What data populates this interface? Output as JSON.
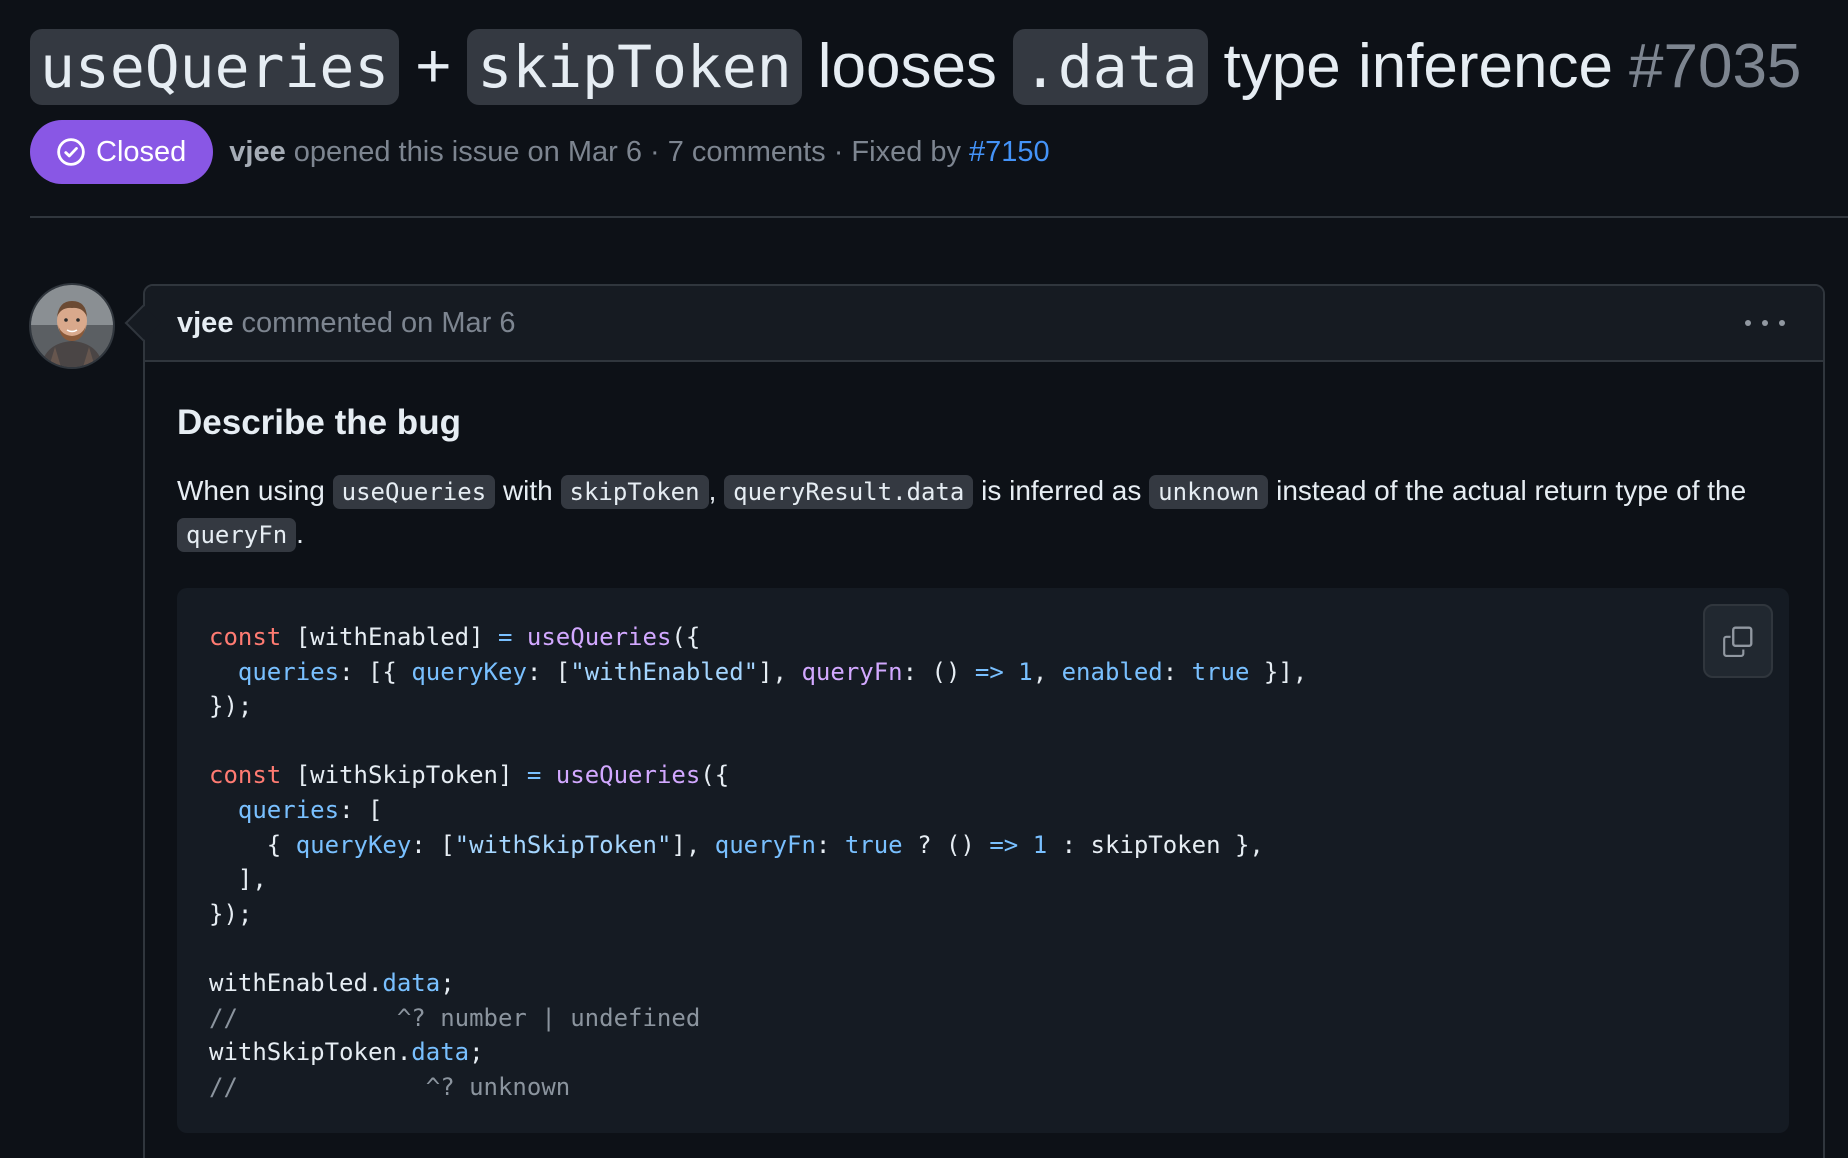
{
  "issue": {
    "title_parts": {
      "code1": "useQueries",
      "plus": "+",
      "code2": "skipToken",
      "word1": "looses",
      "code3": ".data",
      "rest": "type inference",
      "number": "#7035"
    },
    "status_label": "Closed",
    "status_color": "#8957e5",
    "author": "vjee",
    "opened_text": "opened this issue on Mar 6 · 7 comments · Fixed by",
    "fixed_by": "#7150"
  },
  "comment": {
    "author": "vjee",
    "meta": "commented on Mar 6",
    "heading": "Describe the bug",
    "para": {
      "t1": "When using",
      "c1": "useQueries",
      "t2": "with",
      "c2": "skipToken",
      "t3": ",",
      "c3": "queryResult.data",
      "t4": "is inferred as",
      "c4": "unknown",
      "t5": "instead of the actual return type of the",
      "c5": "queryFn",
      "t6": "."
    },
    "code_lines": [
      [
        {
          "t": "const",
          "c": "k"
        },
        {
          "t": " [withEnabled] "
        },
        {
          "t": "=",
          "c": "p"
        },
        {
          "t": " "
        },
        {
          "t": "useQueries",
          "c": "f"
        },
        {
          "t": "({"
        }
      ],
      [
        {
          "t": "  "
        },
        {
          "t": "queries",
          "c": "p"
        },
        {
          "t": ": [{ "
        },
        {
          "t": "queryKey",
          "c": "p"
        },
        {
          "t": ": ["
        },
        {
          "t": "\"withEnabled\"",
          "c": "s"
        },
        {
          "t": "], "
        },
        {
          "t": "queryFn",
          "c": "f"
        },
        {
          "t": ": () "
        },
        {
          "t": "=>",
          "c": "p"
        },
        {
          "t": " "
        },
        {
          "t": "1",
          "c": "p"
        },
        {
          "t": ", "
        },
        {
          "t": "enabled",
          "c": "p"
        },
        {
          "t": ": "
        },
        {
          "t": "true",
          "c": "p"
        },
        {
          "t": " }],"
        }
      ],
      [
        {
          "t": "});"
        }
      ],
      [
        {
          "t": ""
        }
      ],
      [
        {
          "t": "const",
          "c": "k"
        },
        {
          "t": " [withSkipToken] "
        },
        {
          "t": "=",
          "c": "p"
        },
        {
          "t": " "
        },
        {
          "t": "useQueries",
          "c": "f"
        },
        {
          "t": "({"
        }
      ],
      [
        {
          "t": "  "
        },
        {
          "t": "queries",
          "c": "p"
        },
        {
          "t": ": ["
        }
      ],
      [
        {
          "t": "    { "
        },
        {
          "t": "queryKey",
          "c": "p"
        },
        {
          "t": ": ["
        },
        {
          "t": "\"withSkipToken\"",
          "c": "s"
        },
        {
          "t": "], "
        },
        {
          "t": "queryFn",
          "c": "p"
        },
        {
          "t": ": "
        },
        {
          "t": "true",
          "c": "p"
        },
        {
          "t": " ? () "
        },
        {
          "t": "=>",
          "c": "p"
        },
        {
          "t": " "
        },
        {
          "t": "1",
          "c": "p"
        },
        {
          "t": " : skipToken },"
        }
      ],
      [
        {
          "t": "  ],"
        }
      ],
      [
        {
          "t": "});"
        }
      ],
      [
        {
          "t": ""
        }
      ],
      [
        {
          "t": "withEnabled."
        },
        {
          "t": "data",
          "c": "p"
        },
        {
          "t": ";"
        }
      ],
      [
        {
          "t": "//           ^? number | undefined",
          "c": "c"
        }
      ],
      [
        {
          "t": "withSkipToken."
        },
        {
          "t": "data",
          "c": "p"
        },
        {
          "t": ";"
        }
      ],
      [
        {
          "t": "//             ^? unknown",
          "c": "c"
        }
      ]
    ]
  },
  "icons": {
    "status": "check-circle-icon",
    "menu": "kebab-horizontal-icon",
    "copy": "copy-icon"
  }
}
